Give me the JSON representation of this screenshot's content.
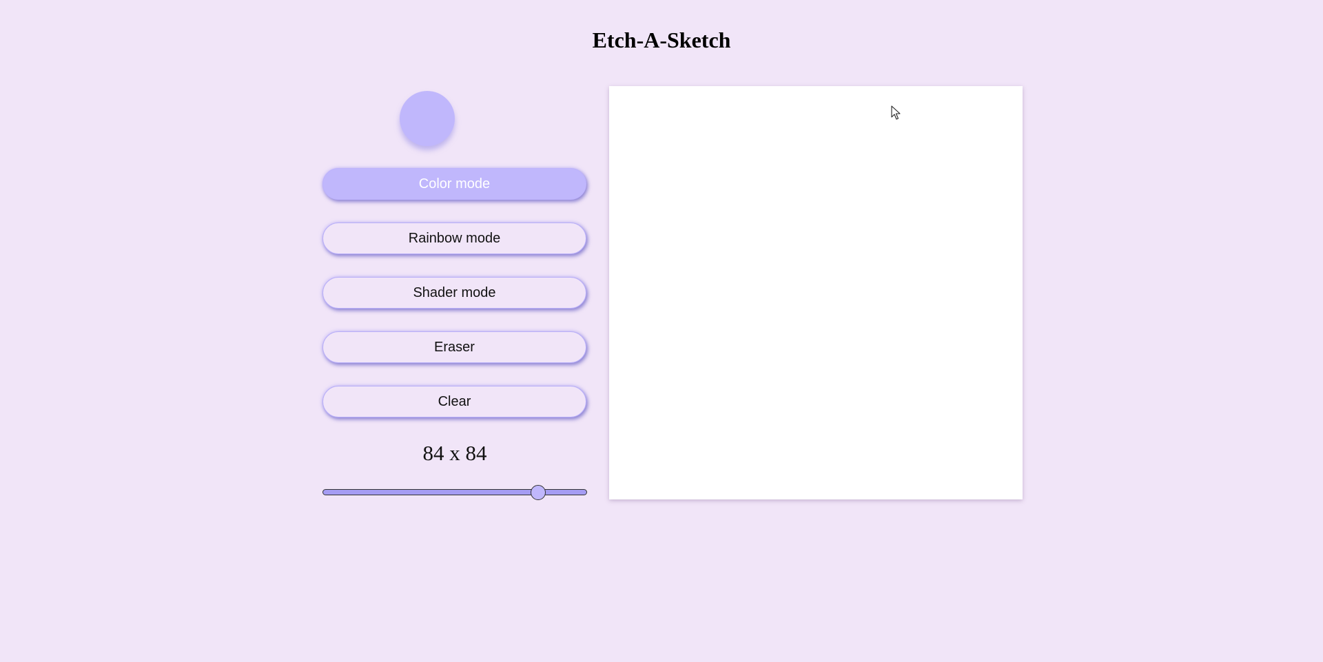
{
  "page": {
    "title": "Etch-A-Sketch",
    "background": "#f1e5f8"
  },
  "color_picker": {
    "value": "#c0b7fc"
  },
  "modes": {
    "accent": "#c0b7fc",
    "items": [
      {
        "label": "Color mode",
        "active": true
      },
      {
        "label": "Rainbow mode",
        "active": false
      },
      {
        "label": "Shader mode",
        "active": false
      },
      {
        "label": "Eraser",
        "active": false
      },
      {
        "label": "Clear",
        "active": false
      }
    ]
  },
  "grid_size": {
    "label": "84 x 84",
    "value": 84,
    "min": 1,
    "max": 100,
    "track_color": "#a59cf3",
    "thumb_color": "#c0b7fc"
  },
  "sketch_board": {
    "background": "#ffffff"
  },
  "icons": {
    "cursor": "mouse-pointer-icon"
  }
}
